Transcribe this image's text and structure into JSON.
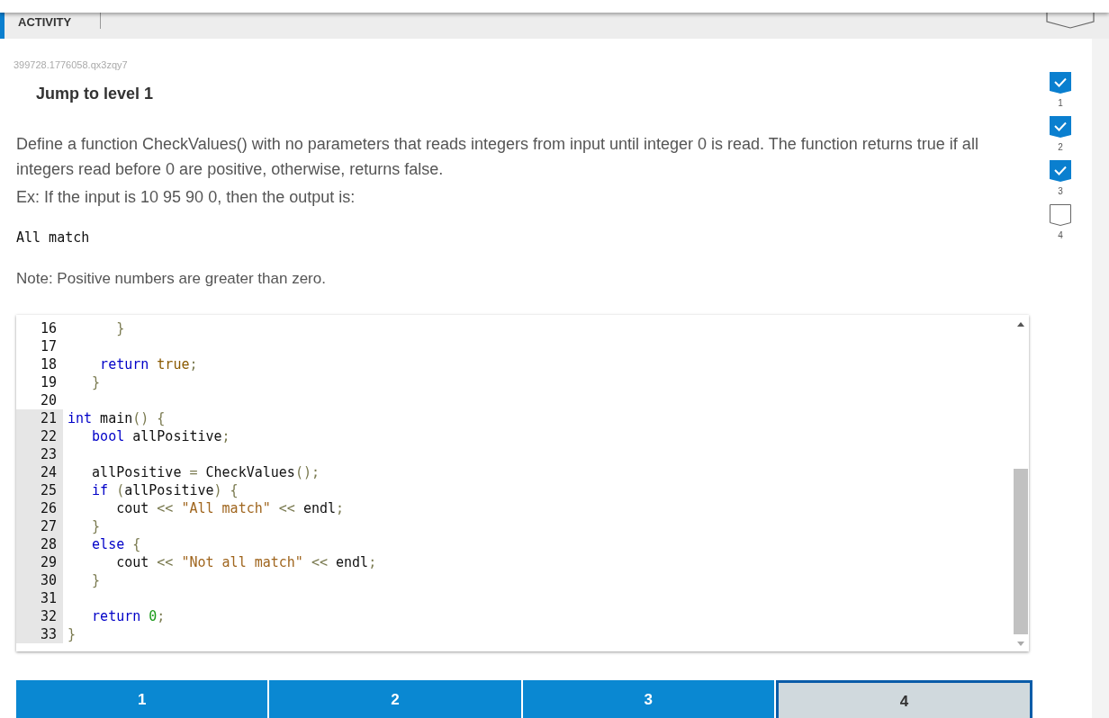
{
  "header": {
    "label": "ACTIVITY"
  },
  "challenge_id": "399728.1776058.qx3zqy7",
  "jump_title": "Jump to level 1",
  "instructions": [
    "Define a function CheckValues() with no parameters that reads integers from input until integer 0 is read. The function returns true if all integers read before 0 are positive, otherwise, returns false.",
    "Ex: If the input is 10 95 90 0, then the output is:"
  ],
  "sample_output": "All match",
  "note": "Note: Positive numbers are greater than zero.",
  "code_lines": [
    {
      "number": "16",
      "active": false,
      "tokens": [
        {
          "kind": "punct",
          "text": "      }"
        }
      ]
    },
    {
      "number": "17",
      "active": false
    },
    {
      "number": "18",
      "active": false,
      "tokens": [
        {
          "kind": "keyword",
          "text": "    return"
        },
        {
          "kind": "literal",
          "text": " true"
        },
        {
          "kind": "punct",
          "text": ";"
        }
      ]
    },
    {
      "number": "19",
      "active": false,
      "tokens": [
        {
          "kind": "punct",
          "text": "   }"
        }
      ]
    },
    {
      "number": "20",
      "active": false
    },
    {
      "number": "21",
      "active": true,
      "tokens": [
        {
          "kind": "keyword",
          "text": "int"
        },
        {
          "kind": "plain",
          "text": " main"
        },
        {
          "kind": "punct",
          "text": "() {"
        }
      ]
    },
    {
      "number": "22",
      "active": true,
      "tokens": [
        {
          "kind": "keyword",
          "text": "   bool"
        },
        {
          "kind": "plain",
          "text": " allPositive"
        },
        {
          "kind": "punct",
          "text": ";"
        }
      ]
    },
    {
      "number": "23",
      "active": true
    },
    {
      "number": "24",
      "active": true,
      "tokens": [
        {
          "kind": "plain",
          "text": "   allPositive "
        },
        {
          "kind": "punct",
          "text": "="
        },
        {
          "kind": "plain",
          "text": " CheckValues"
        },
        {
          "kind": "punct",
          "text": "();"
        }
      ]
    },
    {
      "number": "25",
      "active": true,
      "tokens": [
        {
          "kind": "keyword",
          "text": "   if"
        },
        {
          "kind": "punct",
          "text": " ("
        },
        {
          "kind": "plain",
          "text": "allPositive"
        },
        {
          "kind": "punct",
          "text": ") {"
        }
      ]
    },
    {
      "number": "26",
      "active": true,
      "tokens": [
        {
          "kind": "plain",
          "text": "      cout "
        },
        {
          "kind": "punct",
          "text": "<<"
        },
        {
          "kind": "string",
          "text": " \"All match\""
        },
        {
          "kind": "punct",
          "text": " <<"
        },
        {
          "kind": "plain",
          "text": " endl"
        },
        {
          "kind": "punct",
          "text": ";"
        }
      ]
    },
    {
      "number": "27",
      "active": true,
      "tokens": [
        {
          "kind": "punct",
          "text": "   }"
        }
      ]
    },
    {
      "number": "28",
      "active": true,
      "tokens": [
        {
          "kind": "keyword",
          "text": "   else"
        },
        {
          "kind": "punct",
          "text": " {"
        }
      ]
    },
    {
      "number": "29",
      "active": true,
      "tokens": [
        {
          "kind": "plain",
          "text": "      cout "
        },
        {
          "kind": "punct",
          "text": "<<"
        },
        {
          "kind": "string",
          "text": " \"Not all match\""
        },
        {
          "kind": "punct",
          "text": " <<"
        },
        {
          "kind": "plain",
          "text": " endl"
        },
        {
          "kind": "punct",
          "text": ";"
        }
      ]
    },
    {
      "number": "30",
      "active": true,
      "tokens": [
        {
          "kind": "punct",
          "text": "   }"
        }
      ]
    },
    {
      "number": "31",
      "active": true
    },
    {
      "number": "32",
      "active": true,
      "tokens": [
        {
          "kind": "keyword",
          "text": "   return"
        },
        {
          "kind": "number",
          "text": " 0"
        },
        {
          "kind": "punct",
          "text": ";"
        }
      ]
    },
    {
      "number": "33",
      "active": true,
      "tokens": [
        {
          "kind": "punct",
          "text": "}"
        }
      ]
    }
  ],
  "levels": [
    {
      "label": "1",
      "completed": true,
      "selected": false
    },
    {
      "label": "2",
      "completed": true,
      "selected": false
    },
    {
      "label": "3",
      "completed": true,
      "selected": false
    },
    {
      "label": "4",
      "completed": false,
      "selected": true
    }
  ],
  "checkpoints": [
    {
      "label": "1",
      "checked": true
    },
    {
      "label": "2",
      "checked": true
    },
    {
      "label": "3",
      "checked": true
    },
    {
      "label": "4",
      "checked": false
    }
  ]
}
